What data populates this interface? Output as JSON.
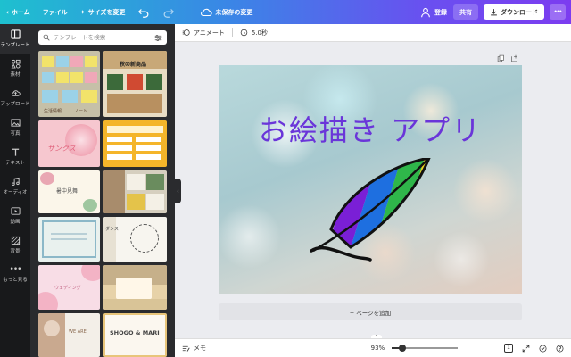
{
  "topbar": {
    "home": "ホーム",
    "file": "ファイル",
    "resize": "サイズを変更",
    "save_status": "未保存の変更",
    "signup": "登録",
    "share": "共有",
    "download": "ダウンロード",
    "more": "•••"
  },
  "rail": [
    {
      "label": "テンプレート",
      "icon": "template-icon"
    },
    {
      "label": "素材",
      "icon": "elements-icon"
    },
    {
      "label": "アップロード",
      "icon": "upload-icon"
    },
    {
      "label": "写真",
      "icon": "photo-icon"
    },
    {
      "label": "テキスト",
      "icon": "text-icon"
    },
    {
      "label": "オーディオ",
      "icon": "audio-icon"
    },
    {
      "label": "動画",
      "icon": "video-icon"
    },
    {
      "label": "背景",
      "icon": "background-icon"
    },
    {
      "label": "もっと見る",
      "icon": "more-icon"
    }
  ],
  "panel": {
    "search_placeholder": "テンプレートを検索",
    "templates": [
      {
        "texts": [
          "生活情報",
          "ノート"
        ]
      },
      {
        "texts": [
          "秋の新商品"
        ]
      },
      {
        "texts": [
          "サンクス"
        ]
      },
      {
        "texts": []
      },
      {
        "texts": [
          "暑中見舞"
        ]
      },
      {
        "texts": []
      },
      {
        "texts": []
      },
      {
        "texts": [
          "ダンス"
        ]
      },
      {
        "texts": [
          "ウェディング"
        ]
      },
      {
        "texts": []
      },
      {
        "texts": [
          "WE ARE"
        ]
      },
      {
        "texts": [
          "SHOGO & MARI"
        ]
      }
    ]
  },
  "editor": {
    "animate": "アニメート",
    "duration": "5.0秒",
    "canvas_title": "お絵描き アプリ",
    "add_page": "+ ページを追加",
    "memo": "メモ",
    "zoom": "93%",
    "zoom_level": 0.16,
    "page_count": "1"
  },
  "colors": {
    "accent": "#6a35d9",
    "feather_stripes": [
      "#7a1fd6",
      "#1e6fe0",
      "#2fb64a",
      "#f2d31b",
      "#f07a12",
      "#e21b1b"
    ]
  }
}
